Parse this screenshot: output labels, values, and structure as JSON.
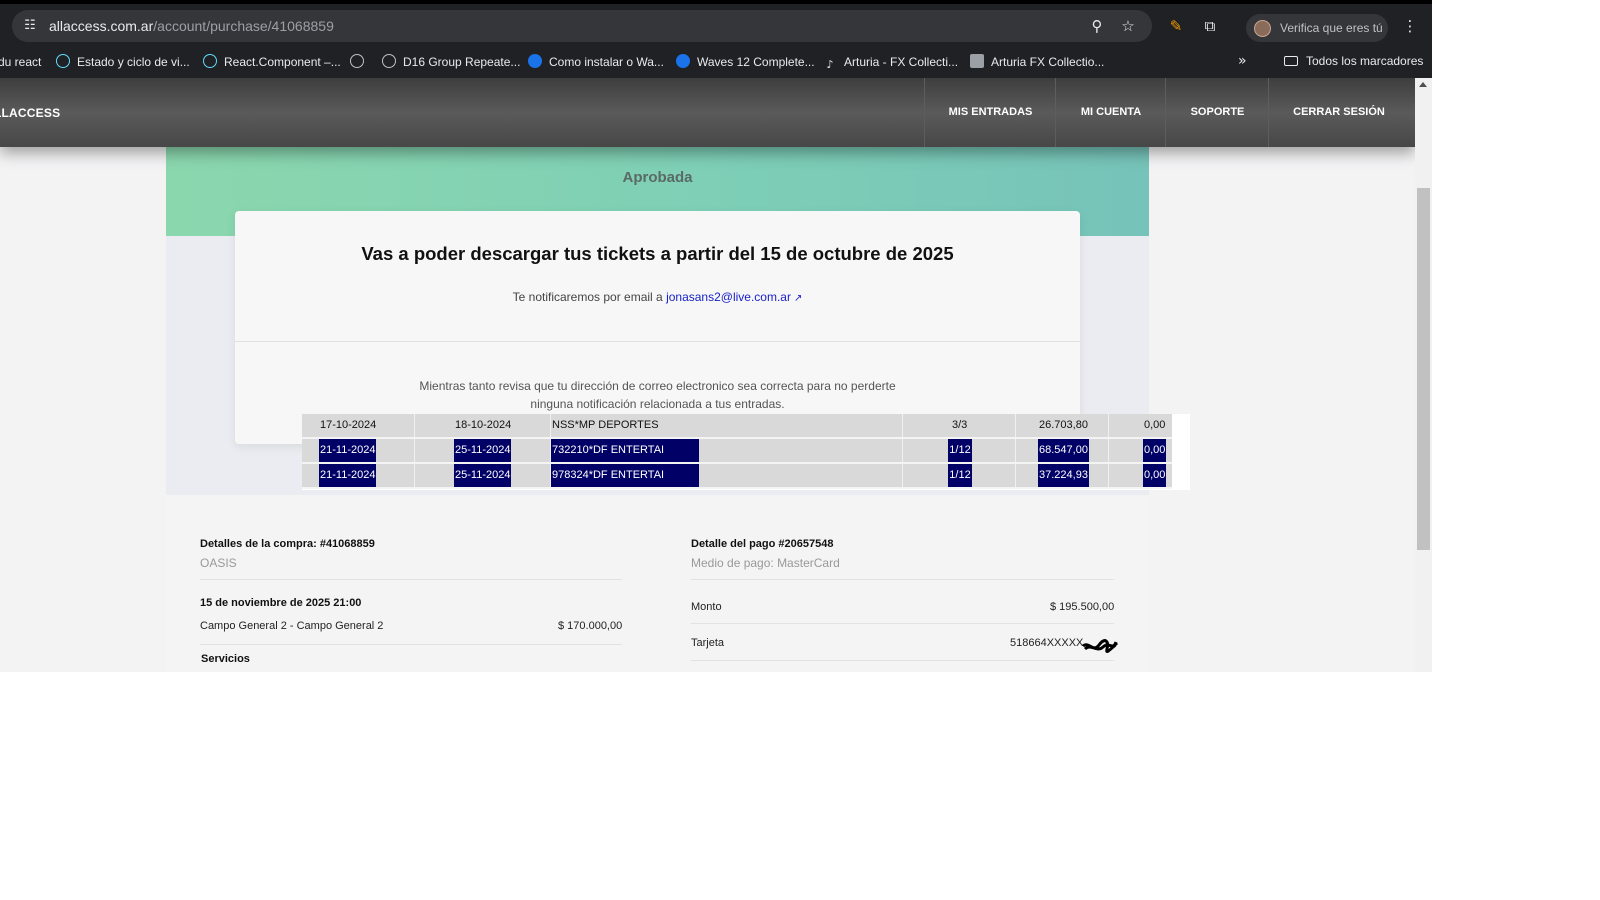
{
  "browser": {
    "url_host": "allaccess.com.ar",
    "url_path": "/account/purchase/41068859",
    "profile_label": "Verifica que eres tú",
    "bookmarks": [
      {
        "label": "du react",
        "icon": "none"
      },
      {
        "label": "Estado y ciclo de vi...",
        "icon": "react-icon"
      },
      {
        "label": "React.Component –...",
        "icon": "react-icon"
      },
      {
        "label": "",
        "icon": "globe-icon"
      },
      {
        "label": "D16 Group Repeate...",
        "icon": "globe-icon"
      },
      {
        "label": "Como instalar o Wa...",
        "icon": "p-icon"
      },
      {
        "label": "Waves 12 Complete...",
        "icon": "p-icon"
      },
      {
        "label": "Arturia - FX Collecti...",
        "icon": "guitar-icon"
      },
      {
        "label": "Arturia FX Collectio...",
        "icon": "image-icon"
      }
    ],
    "all_bookmarks_label": "Todos los marcadores"
  },
  "nav": {
    "brand": "LLACCESS",
    "items": [
      "MIS ENTRADAS",
      "MI CUENTA",
      "SOPORTE",
      "CERRAR SESIÓN"
    ]
  },
  "status": {
    "title": "Aprobada"
  },
  "card": {
    "headline": "Vas a poder descargar tus tickets a partir del 15 de octubre de 2025",
    "notify_prefix": "Te notificaremos por email a",
    "email": "jonasans2@live.com.ar",
    "tip_line1": "Mientras tanto revisa que tu dirección de correo electronico sea correcta para no perderte",
    "tip_line2": "ninguna notificación relacionada a tus entradas."
  },
  "overlay_table": {
    "rows": [
      {
        "date1": "17-10-2024",
        "date2": "18-10-2024",
        "desc": "NSS*MP DEPORTES",
        "cuota": "3/3",
        "amount": "26.703,80",
        "other": "0,00",
        "highlighted": false
      },
      {
        "date1": "21-11-2024",
        "date2": "25-11-2024",
        "desc": "732210*DF ENTERTAI",
        "cuota": "1/12",
        "amount": "68.547,00",
        "other": "0,00",
        "highlighted": true
      },
      {
        "date1": "21-11-2024",
        "date2": "25-11-2024",
        "desc": "978324*DF ENTERTAI",
        "cuota": "1/12",
        "amount": "37.224,93",
        "other": "0,00",
        "highlighted": true
      }
    ]
  },
  "purchase": {
    "title": "Detalles de la compra: #41068859",
    "event": "OASIS",
    "date": "15 de noviembre de 2025 21:00",
    "item_label": "Campo General 2 - Campo General 2",
    "item_price": "$ 170.000,00",
    "services_label": "Servicios"
  },
  "payment": {
    "title": "Detalle del pago #20657548",
    "method": "Medio de pago: MasterCard",
    "amount_label": "Monto",
    "amount_value": "$ 195.500,00",
    "card_label": "Tarjeta",
    "card_value": "518664XXXXX"
  }
}
